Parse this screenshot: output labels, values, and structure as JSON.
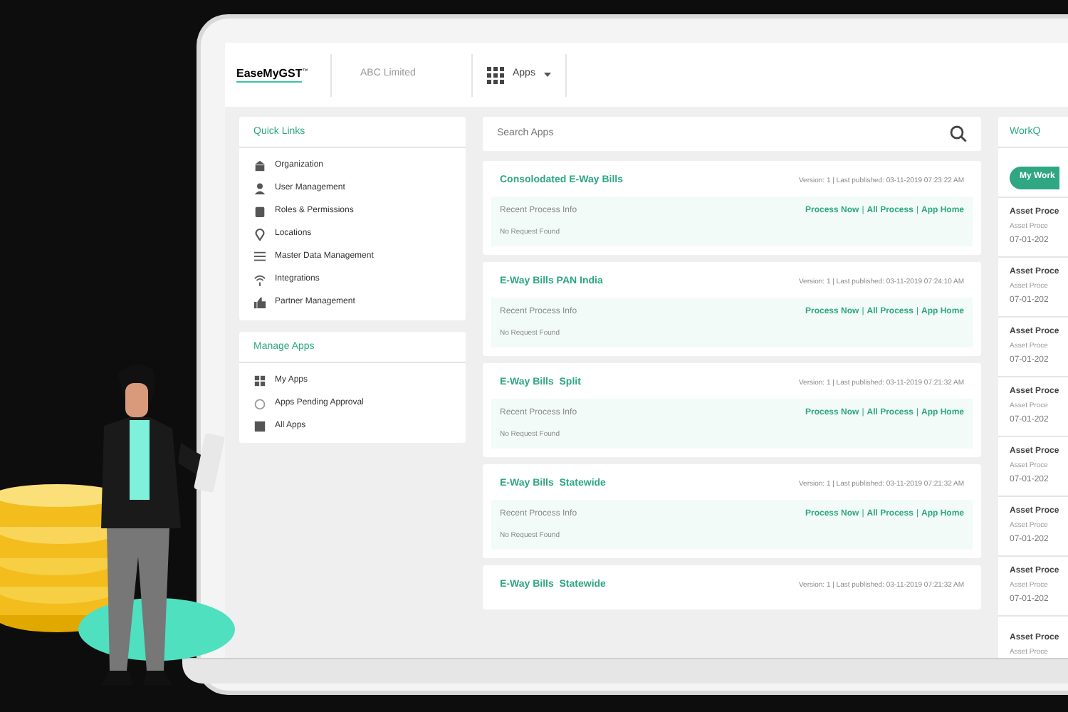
{
  "header": {
    "logo": "EaseMyGST",
    "trademark": "™",
    "company": "ABC Limited",
    "apps_menu": "Apps"
  },
  "quick_links": {
    "title": "Quick Links",
    "items": [
      "Organization",
      "User Management",
      "Roles & Permissions",
      "Locations",
      "Master Data Management",
      "Integrations",
      "Partner Management"
    ]
  },
  "manage_apps": {
    "title": "Manage Apps",
    "items": [
      "My Apps",
      "Apps Pending Approval",
      "All Apps"
    ]
  },
  "search": {
    "placeholder": "Search Apps"
  },
  "apps": [
    {
      "title": "Consolodated E-Way Bills",
      "meta": "Version: 1 | Last published: 03-11-2019 07:23:22 AM",
      "section": "Recent Process Info",
      "links": [
        "Process Now",
        "All Process",
        "App Home"
      ],
      "separators": [
        "|",
        "|"
      ],
      "empty": "No Request Found"
    },
    {
      "title": "E-Way Bills PAN India",
      "meta": "Version: 1 | Last published: 03-11-2019 07:24:10 AM",
      "section": "Recent Process Info",
      "links": [
        "Process Now",
        "All Process",
        "App Home"
      ],
      "separators": [
        "|",
        "|"
      ],
      "empty": "No Request Found"
    },
    {
      "title": "E-Way Bills  Split",
      "meta": "Version: 1 | Last published: 03-11-2019 07:21:32 AM",
      "section": "Recent Process Info",
      "links": [
        "Process Now",
        "All Process",
        "App Home"
      ],
      "separators": [
        "|",
        "|"
      ],
      "empty": "No Request Found"
    },
    {
      "title": "E-Way Bills  Statewide",
      "meta": "Version: 1 | Last published: 03-11-2019 07:21:32 AM",
      "section": "Recent Process Info",
      "links": [
        "Process Now",
        "All Process",
        "App Home"
      ],
      "separators": [
        "|",
        "|"
      ],
      "empty": "No Request Found"
    },
    {
      "title": "E-Way Bills  Statewide",
      "meta": "Version: 1 | Last published: 03-11-2019 07:21:32 AM"
    }
  ],
  "workq": {
    "title": "WorkQ",
    "tab": "My Work",
    "items": [
      {
        "title": "Asset Proce",
        "subtitle": "Asset Proce",
        "date": "07-01-202"
      },
      {
        "title": "Asset Proce",
        "subtitle": "Asset Proce",
        "date": "07-01-202"
      },
      {
        "title": "Asset Proce",
        "subtitle": "Asset Proce",
        "date": "07-01-202"
      },
      {
        "title": "Asset Proce",
        "subtitle": "Asset Proce",
        "date": "07-01-202"
      },
      {
        "title": "Asset Proce",
        "subtitle": "Asset Proce",
        "date": "07-01-202"
      },
      {
        "title": "Asset Proce",
        "subtitle": "Asset Proce",
        "date": "07-01-202"
      },
      {
        "title": "Asset Proce",
        "subtitle": "Asset Proce",
        "date": "07-01-202"
      },
      {
        "title": "Asset Proce",
        "subtitle": "Asset Proce"
      }
    ]
  }
}
